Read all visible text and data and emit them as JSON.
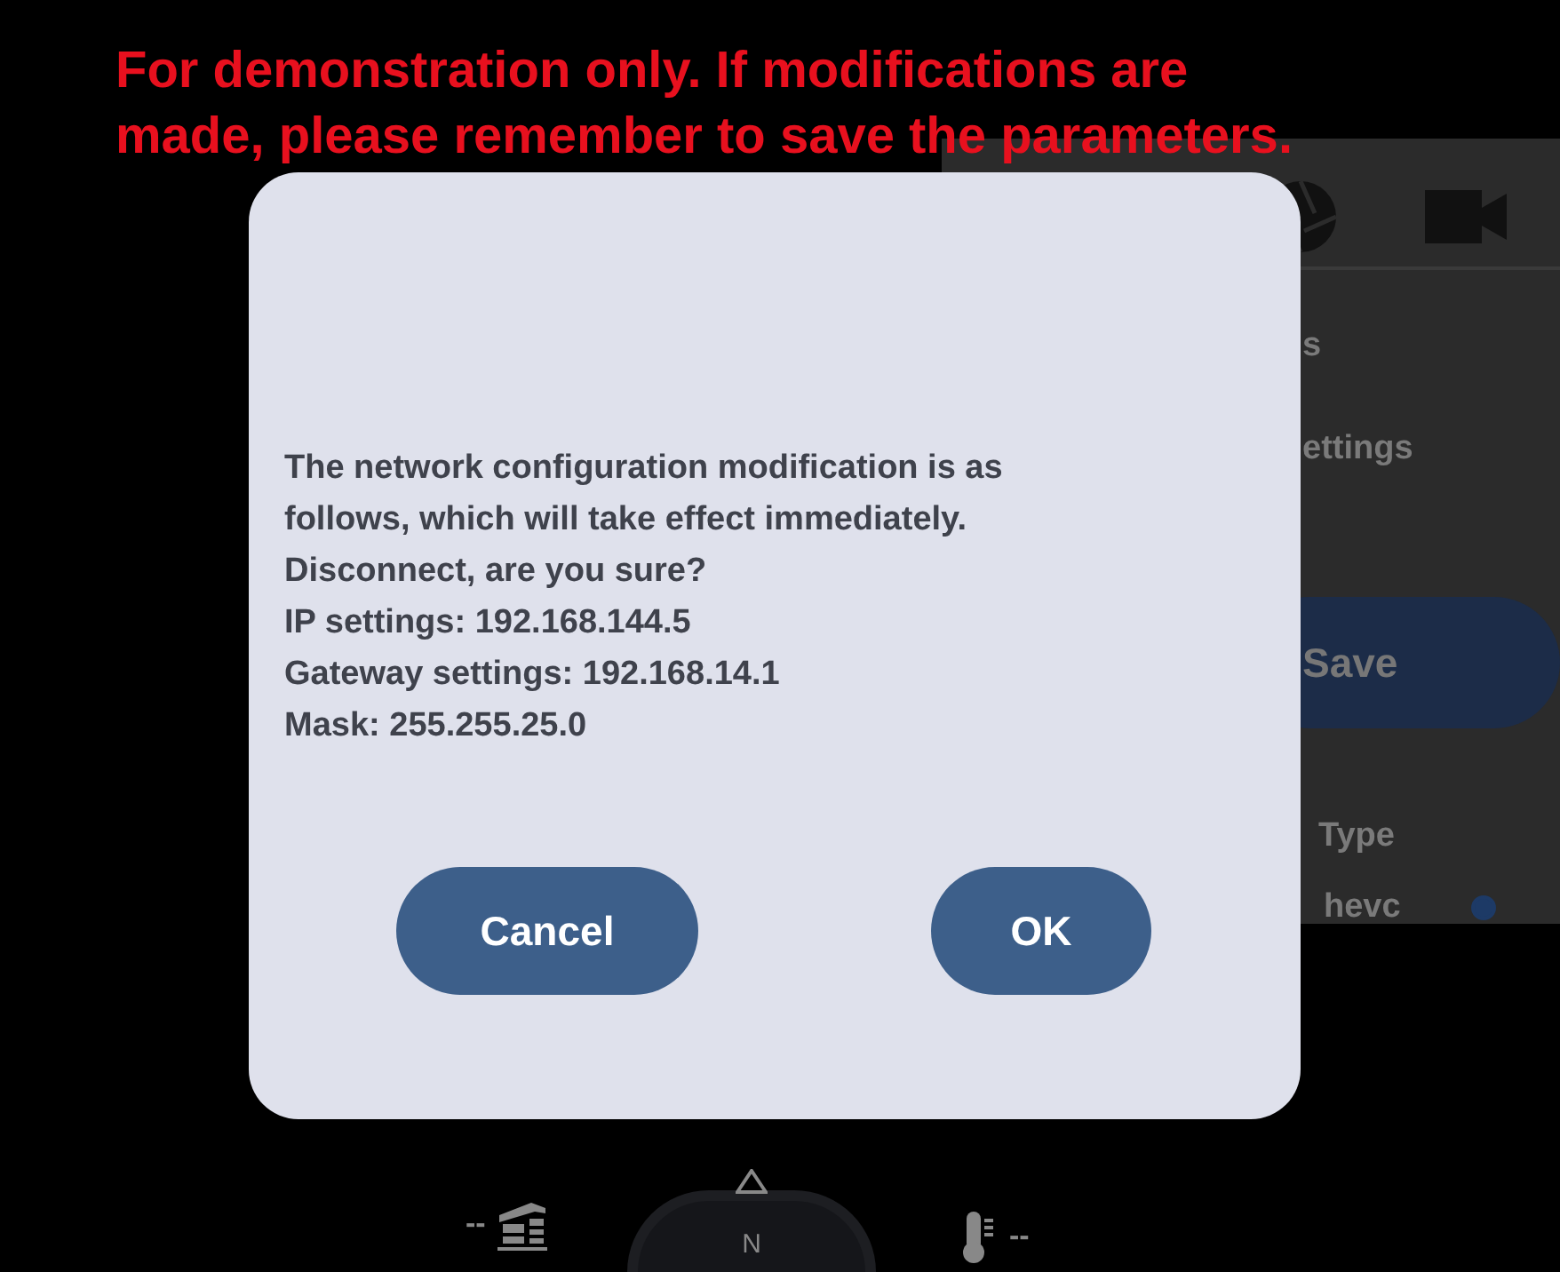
{
  "annotation": {
    "lines": [
      "For demonstration only. If modifications are",
      "made, please remember to save the parameters."
    ]
  },
  "background_panel": {
    "items": [
      {
        "kind": "text",
        "label": "s"
      },
      {
        "kind": "text",
        "label": "ettings"
      },
      {
        "kind": "button",
        "label": "Save"
      },
      {
        "kind": "text",
        "label": "Type"
      },
      {
        "kind": "radio",
        "label": "hevc",
        "selected": true
      }
    ]
  },
  "dialog": {
    "message": [
      "The network configuration modification is as",
      "follows, which will take effect immediately.",
      "Disconnect, are you sure?",
      "IP settings: 192.168.144.5",
      "Gateway settings: 192.168.14.1",
      "Mask: 255.255.25.0"
    ],
    "buttons": [
      {
        "label": "Cancel"
      },
      {
        "label": "OK"
      }
    ]
  },
  "hud": {
    "altitude": "--",
    "compass": "N",
    "temperature": "--"
  }
}
